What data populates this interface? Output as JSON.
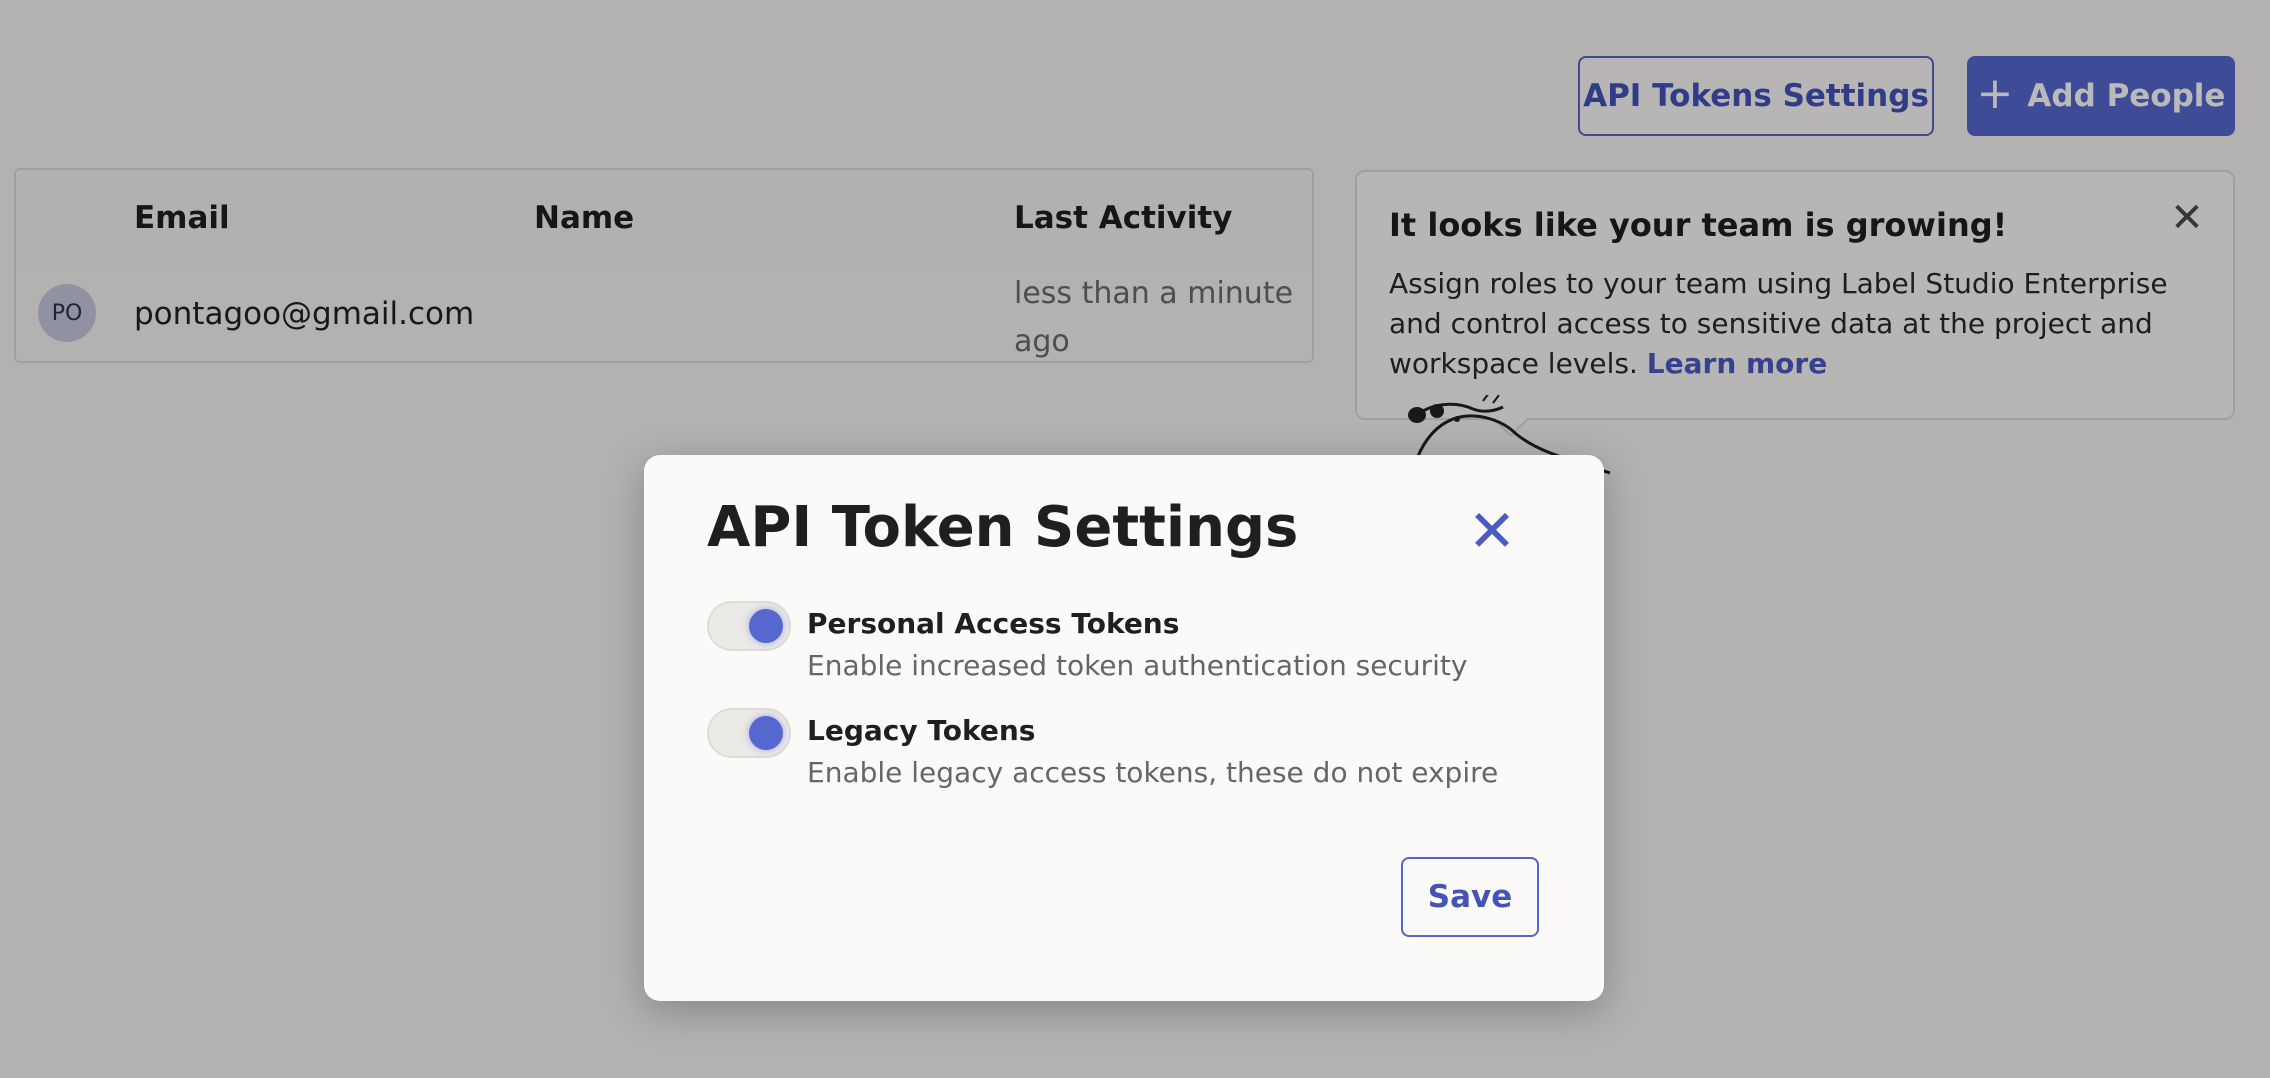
{
  "header": {
    "api_tokens_button": "API Tokens Settings",
    "add_people_button": "Add People",
    "add_icon": "plus-icon"
  },
  "people_table": {
    "columns": [
      "Email",
      "Name",
      "Last Activity"
    ],
    "rows": [
      {
        "avatar_initials": "PO",
        "email": "pontagoo@gmail.com",
        "name": "",
        "last_activity": "less than a minute ago"
      }
    ]
  },
  "callout": {
    "title": "It looks like your team is growing!",
    "body": "Assign roles to your team using Label Studio Enterprise and control access to sensitive data at the project and workspace levels.",
    "link": "Learn more",
    "close_icon": "close-icon"
  },
  "modal": {
    "title": "API Token Settings",
    "close_icon": "close-icon",
    "settings": [
      {
        "label": "Personal Access Tokens",
        "description": "Enable increased token authentication security",
        "enabled": true
      },
      {
        "label": "Legacy Tokens",
        "description": "Enable legacy access tokens, these do not expire",
        "enabled": true
      }
    ],
    "save_label": "Save"
  },
  "colors": {
    "accent": "#5667cf",
    "link": "#4a5bc4",
    "overlay": "rgba(0,0,0,0.27)"
  }
}
